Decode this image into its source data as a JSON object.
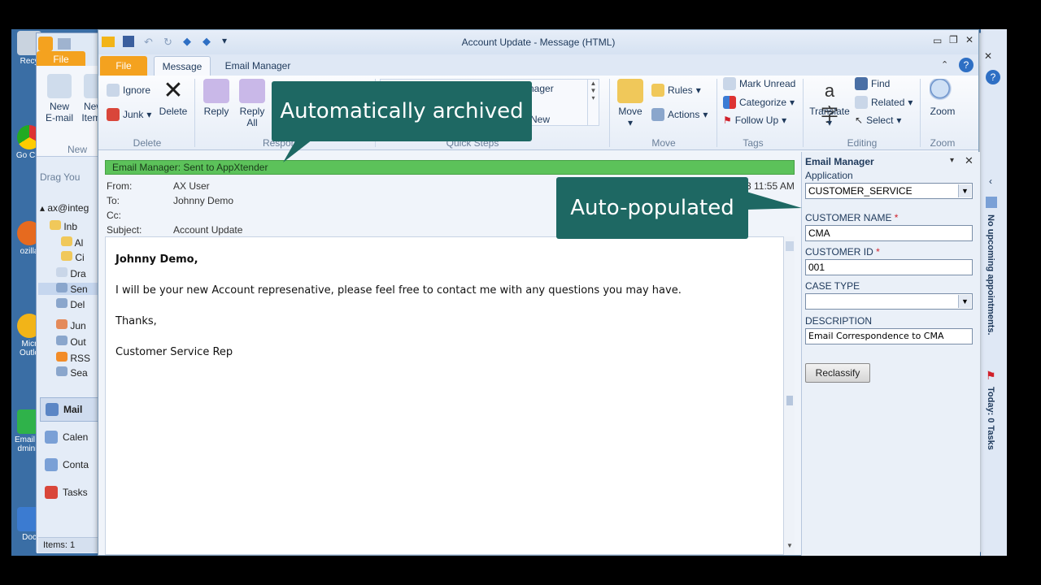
{
  "desktop": {
    "items": [
      {
        "label": "Recy"
      },
      {
        "label": "Go Chr"
      },
      {
        "label": "ozilla"
      },
      {
        "label": "Micr Outlo"
      },
      {
        "label": "Email M dminis"
      },
      {
        "label": "Doc"
      }
    ]
  },
  "back_window": {
    "file_tab": "File",
    "new_email": "New\nE-mail",
    "new_items": "New\nItems",
    "group_new": "New",
    "drag_hint": "Drag You",
    "account": "ax@integ",
    "folders": [
      "Inb",
      "Al",
      "Ci",
      "Dra",
      "Sen",
      "Del",
      "Jun",
      "Out",
      "RSS",
      "Sea"
    ],
    "nav_buttons": [
      "Mail",
      "Calen",
      "Conta",
      "Tasks"
    ],
    "status": "Items: 1"
  },
  "window": {
    "title": "Account Update  -  Message (HTML)"
  },
  "tabs": {
    "file": "File",
    "message": "Message",
    "email_manager": "Email Manager"
  },
  "ribbon": {
    "ignore": "Ignore",
    "junk": "Junk",
    "delete": "Delete",
    "group_delete": "Delete",
    "reply": "Reply",
    "reply_all": "Reply\nAll",
    "group_respond": "Respond",
    "quick_manager": "nager",
    "quick_new": "New",
    "group_quick_steps": "Quick Steps",
    "move": "Move",
    "rules": "Rules",
    "actions": "Actions",
    "group_move": "Move",
    "mark_unread": "Mark Unread",
    "categorize": "Categorize",
    "follow_up": "Follow Up",
    "group_tags": "Tags",
    "translate": "Translate",
    "find": "Find",
    "related": "Related",
    "select": "Select",
    "group_editing": "Editing",
    "zoom": "Zoom",
    "group_zoom": "Zoom"
  },
  "message": {
    "status_banner": "Email Manager: Sent to AppXtender",
    "from_label": "From:",
    "from": "AX User",
    "to_label": "To:",
    "to": "Johnny Demo",
    "cc_label": "Cc:",
    "cc": "",
    "subject_label": "Subject:",
    "subject": "Account Update",
    "time": "3 11:55 AM",
    "body": [
      "Johnny Demo,",
      "I will be your new Account represenative, please feel free to contact me with any questions you may have.",
      "Thanks,",
      "Customer Service Rep"
    ]
  },
  "email_manager": {
    "title": "Email Manager",
    "application_label": "Application",
    "application_value": "CUSTOMER_SERVICE",
    "customer_name_label": "CUSTOMER NAME",
    "customer_name_value": "CMA",
    "customer_id_label": "CUSTOMER ID",
    "customer_id_value": "001",
    "case_type_label": "CASE TYPE",
    "case_type_value": "",
    "description_label": "DESCRIPTION",
    "description_value": "Email Correspondence to CMA",
    "required_mark": "*",
    "reclassify": "Reclassify"
  },
  "todo_bar": {
    "appointments": "No upcoming appointments.",
    "tasks": "Today: 0 Tasks"
  },
  "callouts": {
    "archived": "Automatically archived",
    "populated": "Auto-populated"
  },
  "colors": {
    "banner_green": "#5cc25a",
    "callout_teal": "#1e6863",
    "file_tab_orange": "#f4a21f"
  }
}
